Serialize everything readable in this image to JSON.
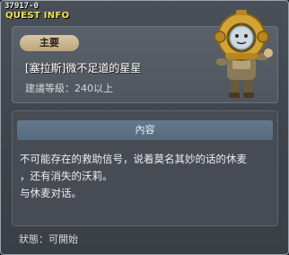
{
  "window": {
    "quest_id": "37917-0",
    "title": "QUEST INFO"
  },
  "summary": {
    "badge": "主要",
    "quest_name": "[塞拉斯]微不足道的星星",
    "level": "建議等級：240以上"
  },
  "detail": {
    "section_label": "內容",
    "lines": [
      "不可能存在的救助信号，说着莫名其妙的话的休麦",
      "，还有消失的沃莉。",
      "与休麦对话。"
    ]
  },
  "footer": {
    "status": "狀態：可開始"
  },
  "npc": {
    "icon": "diver-helmet-npc"
  }
}
